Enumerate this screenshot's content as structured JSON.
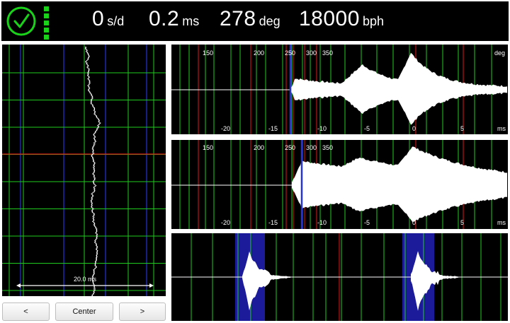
{
  "header": {
    "rate": {
      "value": "0",
      "unit": "s/d"
    },
    "beat_error": {
      "value": "0.2",
      "unit": "ms"
    },
    "amplitude": {
      "value": "278",
      "unit": "deg"
    },
    "bph": {
      "value": "18000",
      "unit": "bph"
    }
  },
  "timegrapher": {
    "span_label": "20.0 ms"
  },
  "controls": {
    "prev_label": "<",
    "center_label": "Center",
    "next_label": ">"
  },
  "waveform_top": {
    "deg_ticks": [
      "150",
      "200",
      "250",
      "300",
      "350"
    ],
    "deg_unit": "deg",
    "ms_ticks": [
      "-20",
      "-15",
      "-10",
      "-5",
      "0",
      "5"
    ],
    "ms_unit": "ms"
  },
  "waveform_mid": {
    "deg_ticks": [
      "150",
      "200",
      "250",
      "300",
      "350"
    ],
    "ms_ticks": [
      "-20",
      "-15",
      "-10",
      "-5",
      "0",
      "5"
    ],
    "ms_unit": "ms"
  },
  "colors": {
    "grid": "#1ecb1e",
    "marker_red": "#e01818",
    "marker_blue": "#2633d6",
    "highlight": "#1c1c9a",
    "status_green": "#1bd21b"
  },
  "icons": [
    "clock-check-icon"
  ]
}
